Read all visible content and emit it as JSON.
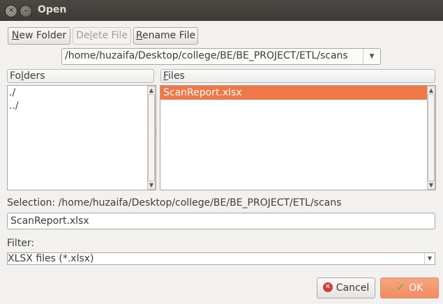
{
  "window": {
    "title": "Open"
  },
  "toolbar": {
    "new_folder_label": "New Folder",
    "new_folder_mnemonic": "N",
    "new_folder_rest": "ew Folder",
    "delete_file_pre": "De",
    "delete_file_mnemonic": "l",
    "delete_file_rest": "ete File",
    "rename_file_mnemonic": "R",
    "rename_file_rest": "ename File"
  },
  "path_combo": {
    "value": "/home/huzaifa/Desktop/college/BE/BE_PROJECT/ETL/scans"
  },
  "folders": {
    "header_pre": "Fo",
    "header_mnemonic": "l",
    "header_rest": "ders",
    "items": [
      "./",
      "../"
    ]
  },
  "files": {
    "header_mnemonic": "F",
    "header_rest": "iles",
    "items": [
      {
        "name": "ScanReport.xlsx",
        "selected": true
      }
    ]
  },
  "selection": {
    "label": "Selection: /home/huzaifa/Desktop/college/BE/BE_PROJECT/ETL/scans",
    "value": "ScanReport.xlsx"
  },
  "filter": {
    "label": "Filter:",
    "value": "XLSX files (*.xlsx)"
  },
  "buttons": {
    "cancel_label": "Cancel",
    "ok_label": "OK"
  },
  "colors": {
    "accent": "#f07746",
    "titlebar": "#3c3b37",
    "ok_button": "#f08c63"
  }
}
